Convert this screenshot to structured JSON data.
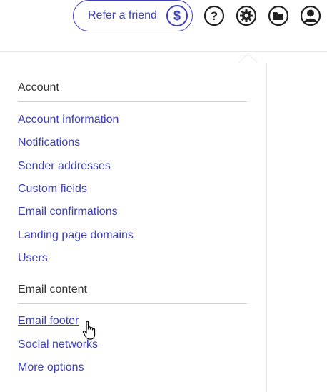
{
  "header": {
    "refer_label": "Refer a friend",
    "refer_symbol": "$",
    "help_symbol": "?"
  },
  "menu": {
    "account": {
      "title": "Account",
      "items": [
        "Account information",
        "Notifications",
        "Sender addresses",
        "Custom fields",
        "Email confirmations",
        "Landing page domains",
        "Users"
      ]
    },
    "email_content": {
      "title": "Email content",
      "items": [
        "Email footer",
        "Social networks",
        "More options"
      ]
    }
  },
  "colors": {
    "accent": "#3c3fb5",
    "text": "#333333",
    "divider": "#d0d0d0"
  }
}
